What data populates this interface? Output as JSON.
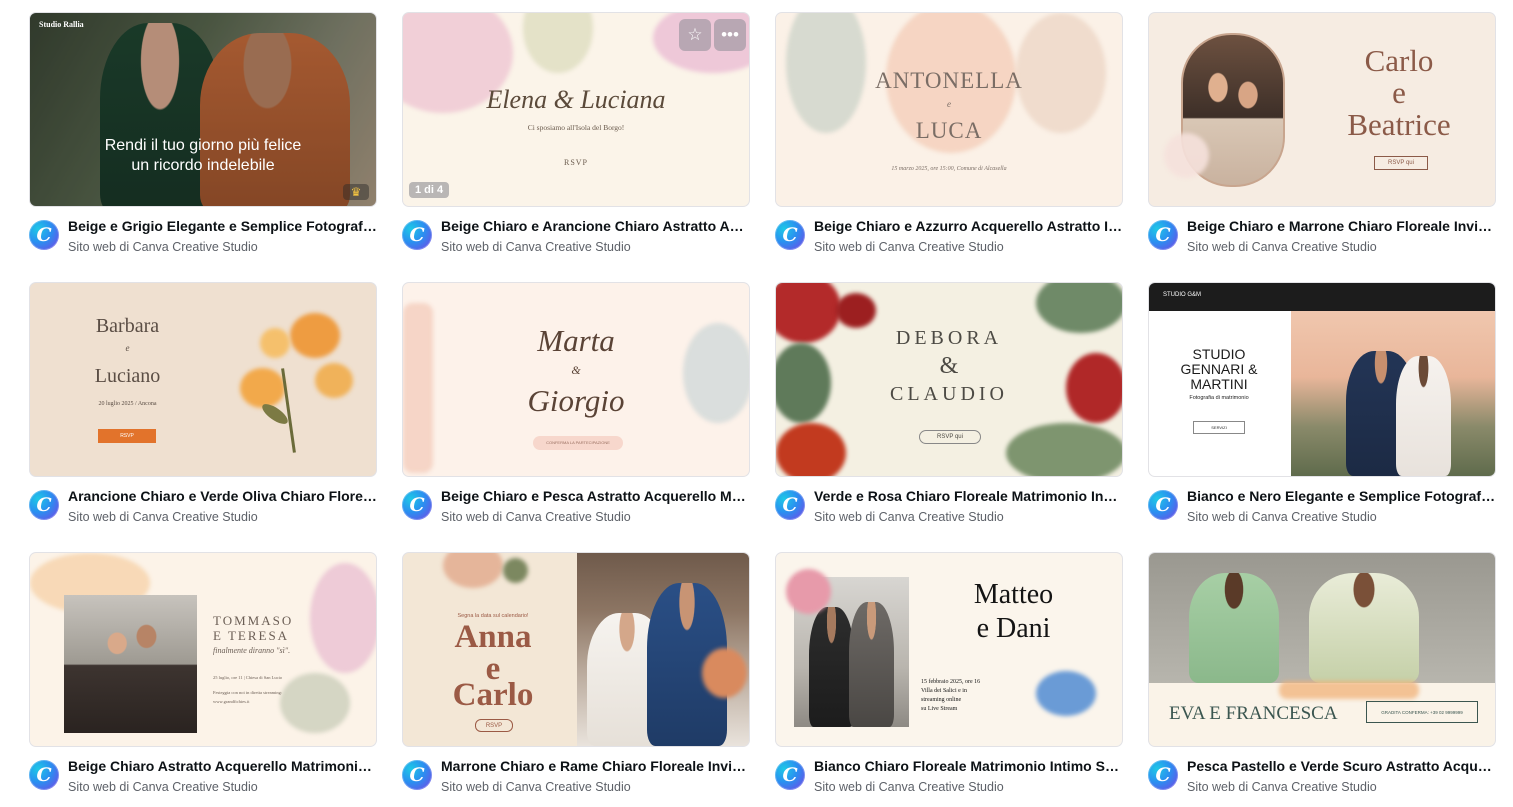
{
  "author_line": "Sito web di Canva Creative Studio",
  "avatar_letter": "C",
  "colors": {
    "accent_orange": "#e2732b",
    "subtitle_gray": "#5d6168"
  },
  "cards": [
    {
      "title": "Beige e Grigio Elegante e Semplice Fotografia Matrimonio",
      "thumb": {
        "brand": "Studio Rallia",
        "headline_1": "Rendi il tuo giorno più felice",
        "headline_2": "un ricordo indelebile",
        "premium_icon": "crown-icon"
      }
    },
    {
      "title": "Beige Chiaro e Arancione Chiaro Astratto Acquerello Matrimonio",
      "thumb": {
        "names": "Elena & Luciana",
        "tagline": "Ci sposiamo all'Isola del Borgo!",
        "rsvp": "RSVP",
        "page_badge": "1 di 4",
        "star_icon": "star-icon",
        "more_icon": "more-icon"
      }
    },
    {
      "title": "Beige Chiaro e Azzurro Acquerello Astratto Invito Matrimonio",
      "thumb": {
        "name_1": "ANTONELLA",
        "amp": "e",
        "name_2": "LUCA",
        "date": "15 marzo 2025, ore 15:00, Comune di Alcasella"
      }
    },
    {
      "title": "Beige Chiaro e Marrone Chiaro Floreale Invito Matrimonio",
      "thumb": {
        "name_1": "Carlo",
        "amp": "e",
        "name_2": "Beatrice",
        "rsvp": "RSVP qui"
      }
    },
    {
      "title": "Arancione Chiaro e Verde Oliva Chiaro Floreale Matrimonio",
      "thumb": {
        "name_1": "Barbara",
        "amp": "e",
        "name_2": "Luciano",
        "date": "20 luglio 2025 / Ancona",
        "rsvp": "RSVP"
      }
    },
    {
      "title": "Beige Chiaro e Pesca Astratto Acquerello Matrimonio",
      "thumb": {
        "name_1": "Marta",
        "amp": "&",
        "name_2": "Giorgio",
        "cta": "CONFERMA LA PARTECIPAZIONE"
      }
    },
    {
      "title": "Verde e Rosa Chiaro Floreale Matrimonio Invito",
      "thumb": {
        "name_1": "DEBORA",
        "amp": "&",
        "name_2": "CLAUDIO",
        "rsvp": "RSVP qui"
      }
    },
    {
      "title": "Bianco e Nero Elegante e Semplice Fotografia Matrimonio",
      "thumb": {
        "brand": "STUDIO G&M",
        "headline_1": "STUDIO",
        "headline_2": "GENNARI &",
        "headline_3": "MARTINI",
        "sub": "Fotografia di matrimonio",
        "btn": "SERVIZI"
      }
    },
    {
      "title": "Beige Chiaro Astratto Acquerello Matrimonio Invito",
      "thumb": {
        "name_1": "TOMMASO",
        "name_2": "E TERESA",
        "tagline": "finalmente diranno \"sì\".",
        "date": "25 luglio, ore 11 | Chiesa di San Lucio",
        "stream": "Festeggia con noi in diretta streaming:",
        "url": "www.grandfichies.it"
      }
    },
    {
      "title": "Marrone Chiaro e Rame Chiaro Floreale Invito Matrimonio",
      "thumb": {
        "kicker": "Segna la data sul calendario!",
        "name_1": "Anna",
        "amp": "e",
        "name_2": "Carlo",
        "rsvp": "RSVP"
      }
    },
    {
      "title": "Bianco Chiaro Floreale Matrimonio Intimo Streaming",
      "thumb": {
        "name_1": "Matteo",
        "name_2": "e Dani",
        "date": "15 febbraio 2025, ore 16",
        "place": "Villa dei Salici e in",
        "stream": "streaming online",
        "live": "su Live Stream"
      }
    },
    {
      "title": "Pesca Pastello e Verde Scuro Astratto Acquerello Matrimonio",
      "thumb": {
        "names": "EVA E FRANCESCA",
        "btn": "GRADITA CONFERMA: +39 02 9999999"
      }
    }
  ]
}
